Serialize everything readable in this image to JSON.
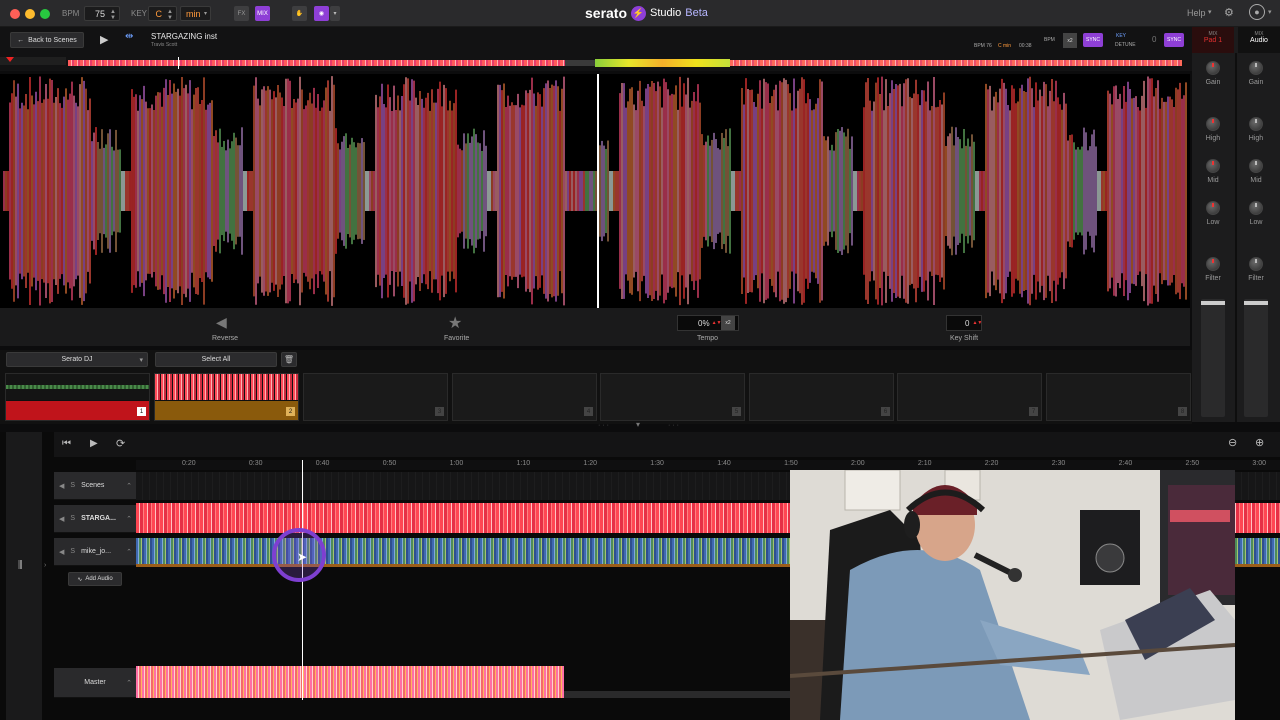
{
  "titlebar": {
    "bpm_label": "BPM",
    "bpm_value": "75",
    "key_label": "KEY",
    "key_value": "C",
    "key_mode": "min",
    "fx_label": "FX",
    "mix_label": "MIX",
    "brand": "serato",
    "product": "Studio",
    "edition": "Beta",
    "help": "Help"
  },
  "deck": {
    "back_label": "Back to Scenes",
    "track_title": "STARGAZING inst",
    "track_artist": "Travis Scott",
    "bpm_readout": "BPM 76",
    "key_readout": "C min",
    "time_readout": "00:38",
    "bpm_label": "BPM",
    "sync_label": "SYNC",
    "key_label": "KEY",
    "detune_label": "DETUNE",
    "detune_value": "0",
    "sync2_label": "SYNC"
  },
  "controls": {
    "reverse": "Reverse",
    "favorite": "Favorite",
    "tempo_value": "0%",
    "tempo_label": "Tempo",
    "keyshift_value": "0",
    "keyshift_label": "Key Shift"
  },
  "pads": {
    "source": "Serato DJ",
    "select_all": "Select All",
    "numbers": [
      "1",
      "2",
      "3",
      "4",
      "5",
      "6",
      "7",
      "8"
    ]
  },
  "mixer": {
    "ch1_top": "MIX",
    "ch1_name": "Pad 1",
    "ch2_top": "MIX",
    "ch2_name": "Audio",
    "knobs": [
      "Gain",
      "High",
      "Mid",
      "Low",
      "Filter"
    ]
  },
  "arranger": {
    "ruler": [
      "0:20",
      "0:30",
      "0:40",
      "0:50",
      "1:00",
      "1:10",
      "1:20",
      "1:30",
      "1:40",
      "1:50",
      "2:00",
      "2:10",
      "2:20",
      "2:30",
      "2:40",
      "2:50",
      "3:00"
    ],
    "tracks": [
      {
        "name": "Scenes"
      },
      {
        "name": "STARGA..."
      },
      {
        "name": "mike_jo..."
      }
    ],
    "add_audio": "Add Audio",
    "master": "Master"
  },
  "colors": {
    "accent": "#8e3fd6",
    "red": "#c0141b",
    "gold": "#8a5a0c",
    "wave_red": "#ff3b3b",
    "wave_pink": "#ff7aa6"
  }
}
